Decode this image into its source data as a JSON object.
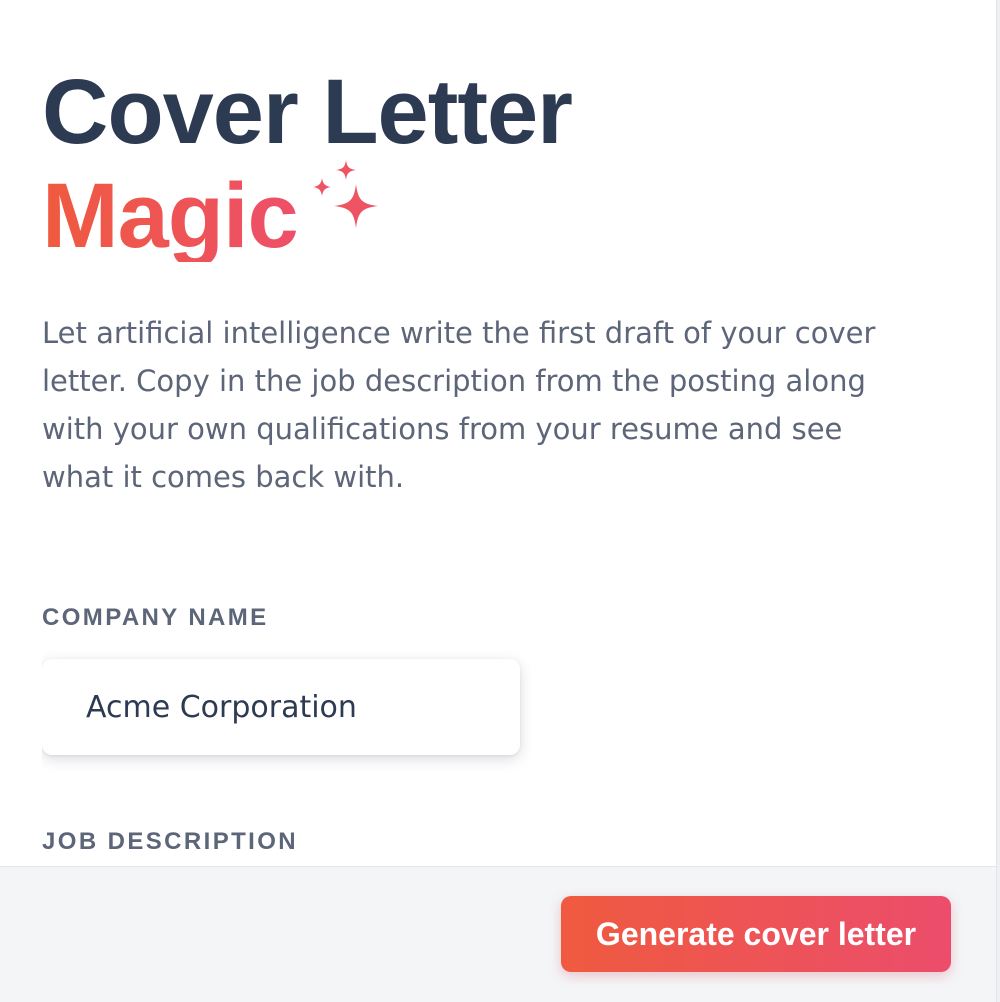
{
  "header": {
    "title_line1": "Cover Letter",
    "title_line2": "Magic",
    "title_icon": "sparkles-icon"
  },
  "intro": {
    "text": "Let artificial intelligence write the first draft of your cover letter. Copy in the job description from the posting along with your own qualifications from your resume and see what it comes back with."
  },
  "form": {
    "company_name": {
      "label": "COMPANY NAME",
      "value": "Acme Corporation"
    },
    "job_description": {
      "label": "JOB DESCRIPTION"
    }
  },
  "footer": {
    "generate_label": "Generate cover letter"
  },
  "colors": {
    "heading": "#2c3a52",
    "accent_start": "#ef5a3f",
    "accent_end": "#ee4f6a",
    "body_text": "#5d6578",
    "footer_bg": "#f4f5f7"
  }
}
